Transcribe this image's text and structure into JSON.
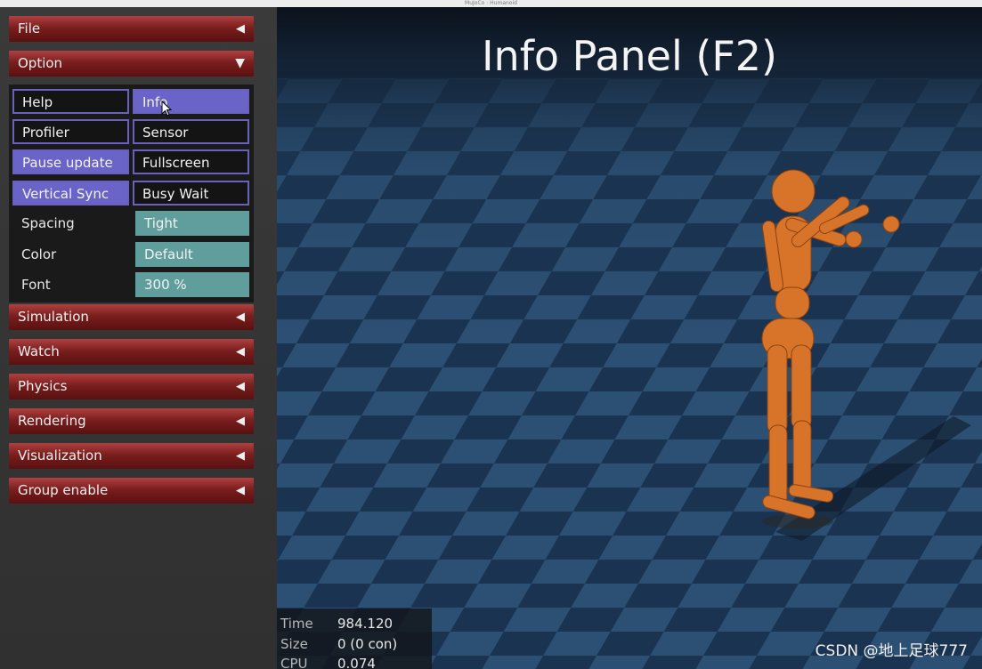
{
  "window": {
    "title": "MuJoCo : Humanoid"
  },
  "sidebar": {
    "sections": {
      "file": {
        "label": "File",
        "arrow": "◀"
      },
      "option": {
        "label": "Option",
        "arrow": "▼"
      },
      "simulation": {
        "label": "Simulation",
        "arrow": "◀"
      },
      "watch": {
        "label": "Watch",
        "arrow": "◀"
      },
      "physics": {
        "label": "Physics",
        "arrow": "◀"
      },
      "rendering": {
        "label": "Rendering",
        "arrow": "◀"
      },
      "visualization": {
        "label": "Visualization",
        "arrow": "◀"
      },
      "group_enable": {
        "label": "Group enable",
        "arrow": "◀"
      }
    },
    "option": {
      "toggles": {
        "help": {
          "label": "Help",
          "active": false
        },
        "info": {
          "label": "Info",
          "active": true
        },
        "profiler": {
          "label": "Profiler",
          "active": false
        },
        "sensor": {
          "label": "Sensor",
          "active": false
        },
        "pause_update": {
          "label": "Pause update",
          "active": true
        },
        "fullscreen": {
          "label": "Fullscreen",
          "active": false
        },
        "vertical_sync": {
          "label": "Vertical Sync",
          "active": true
        },
        "busy_wait": {
          "label": "Busy Wait",
          "active": false
        }
      },
      "spacing": {
        "label": "Spacing",
        "value": "Tight"
      },
      "color": {
        "label": "Color",
        "value": "Default"
      },
      "font": {
        "label": "Font",
        "value": "300 %"
      }
    }
  },
  "viewport": {
    "info_title": "Info Panel (F2)",
    "stats": {
      "time": {
        "label": "Time",
        "value": "984.120"
      },
      "size": {
        "label": "Size",
        "value": "0  (0 con)"
      },
      "cpu": {
        "label": "CPU",
        "value": "0.074"
      }
    },
    "watermark": "CSDN @地上足球777"
  },
  "colors": {
    "header_red": "#7a1e1e",
    "toggle_on": "#6a64c8",
    "toggle_border": "#6a60c0",
    "select_teal": "#5f9e9c",
    "humanoid_orange": "#d8742a"
  }
}
